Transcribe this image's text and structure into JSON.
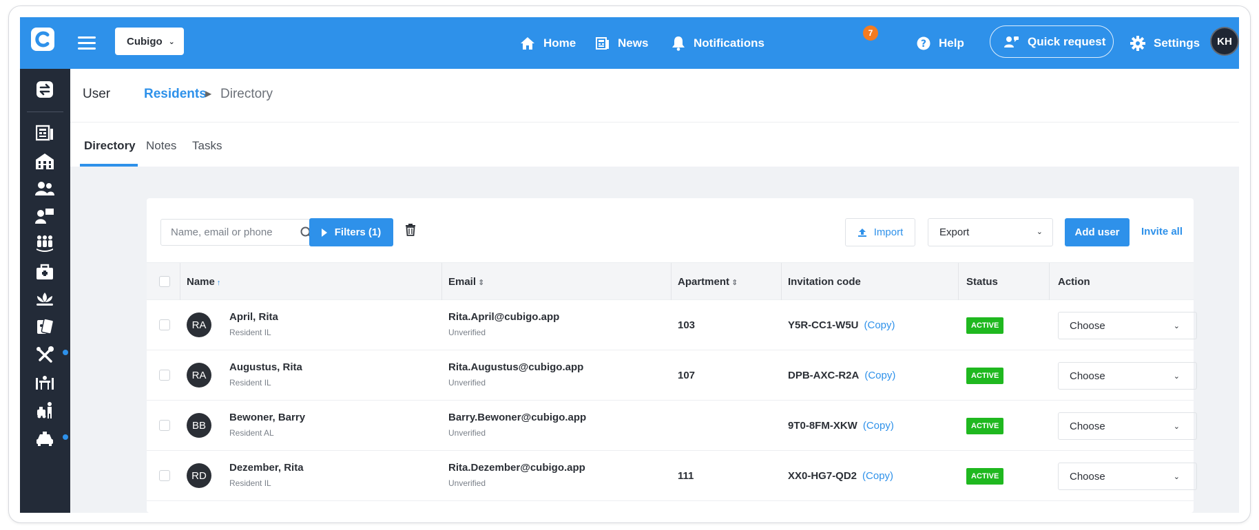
{
  "topbar": {
    "org": "Cubigo",
    "nav": {
      "home": "Home",
      "news": "News",
      "notifications": "Notifications",
      "notifications_count": "7",
      "help": "Help",
      "quick_request": "Quick request",
      "settings": "Settings"
    },
    "avatar_initials": "KH"
  },
  "breadcrumb": {
    "section": "User",
    "parent": "Residents",
    "current": "Directory"
  },
  "tabs": [
    "Directory",
    "Notes",
    "Tasks"
  ],
  "toolbar": {
    "search_placeholder": "Name, email or phone",
    "filters_label": "Filters (1)",
    "import_label": "Import",
    "export_label": "Export",
    "add_user_label": "Add user",
    "invite_all_label": "Invite all"
  },
  "table": {
    "columns": {
      "name": "Name",
      "email": "Email",
      "apartment": "Apartment",
      "invitation_code": "Invitation code",
      "status": "Status",
      "action": "Action"
    },
    "copy_label": "(Copy)",
    "choose_label": "Choose",
    "rows": [
      {
        "initials": "RA",
        "name": "April, Rita",
        "role": "Resident IL",
        "email": "Rita.April@cubigo.app",
        "email_state": "Unverified",
        "apartment": "103",
        "code": "Y5R-CC1-W5U",
        "status": "ACTIVE"
      },
      {
        "initials": "RA",
        "name": "Augustus, Rita",
        "role": "Resident IL",
        "email": "Rita.Augustus@cubigo.app",
        "email_state": "Unverified",
        "apartment": "107",
        "code": "DPB-AXC-R2A",
        "status": "ACTIVE"
      },
      {
        "initials": "BB",
        "name": "Bewoner, Barry",
        "role": "Resident AL",
        "email": "Barry.Bewoner@cubigo.app",
        "email_state": "Unverified",
        "apartment": "",
        "code": "9T0-8FM-XKW",
        "status": "ACTIVE"
      },
      {
        "initials": "RD",
        "name": "Dezember, Rita",
        "role": "Resident IL",
        "email": "Rita.Dezember@cubigo.app",
        "email_state": "Unverified",
        "apartment": "111",
        "code": "XX0-HG7-QD2",
        "status": "ACTIVE"
      }
    ]
  },
  "colors": {
    "brand": "#2e91ea",
    "rail": "#232b38",
    "active": "#1fb81f",
    "badge": "#f47b20"
  }
}
